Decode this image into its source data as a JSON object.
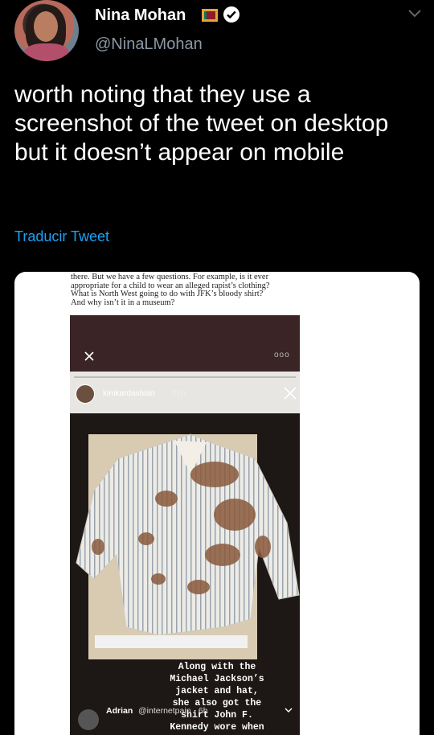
{
  "author": {
    "name": "Nina Mohan",
    "handle": "@NinaLMohan",
    "flag_icon": "sri-lanka-flag-icon",
    "verified_icon": "verified-badge-icon"
  },
  "tweet": {
    "text": "worth noting that they use a screenshot of the tweet on desktop but it doesn’t appear on mobile",
    "translate_label": "Traducir Tweet"
  },
  "media": {
    "article_lines": [
      "there. But we have a few questions. For example, is it ever",
      "appropriate for a child to wear an alleged rapist’s clothing?",
      "What is North West going to do with JFK’s bloody shirt?",
      "And why isn’t it in a museum?"
    ],
    "story_more": "ooo",
    "story_user": "kimkardashian",
    "story_time": "21h",
    "overlay_lines": [
      "Along with the",
      "Michael Jackson’s",
      "jacket and hat,",
      "she also got the",
      "shirt John F.",
      "Kennedy wore when"
    ],
    "reply_name": "Adrian",
    "reply_handle": "@internetpain · 6h"
  },
  "colors": {
    "background": "#000000",
    "link": "#1da1f2",
    "muted": "#8b98a5",
    "story_bg": "#3a2426"
  }
}
